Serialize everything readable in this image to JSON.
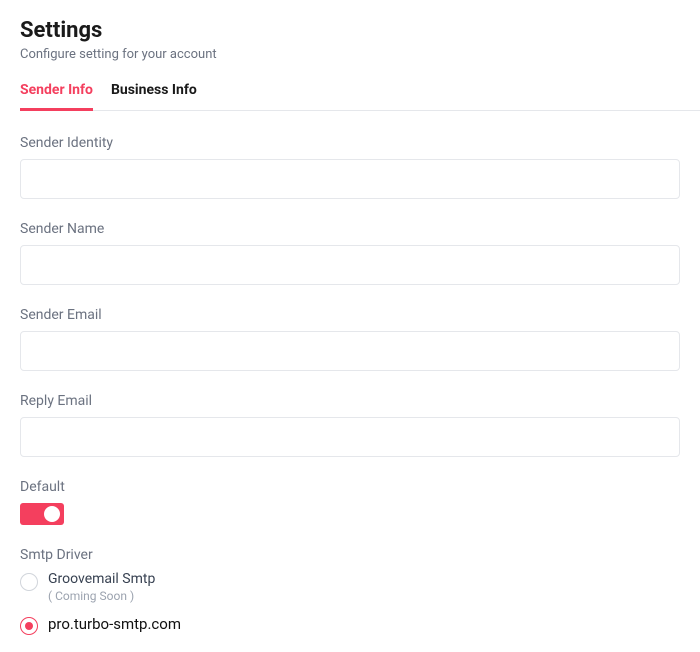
{
  "header": {
    "title": "Settings",
    "subtitle": "Configure setting for your account"
  },
  "tabs": {
    "sender_info": "Sender Info",
    "business_info": "Business Info"
  },
  "fields": {
    "sender_identity": {
      "label": "Sender Identity",
      "value": ""
    },
    "sender_name": {
      "label": "Sender Name",
      "value": ""
    },
    "sender_email": {
      "label": "Sender Email",
      "value": ""
    },
    "reply_email": {
      "label": "Reply Email",
      "value": ""
    }
  },
  "default_toggle": {
    "label": "Default",
    "value": true
  },
  "smtp_driver": {
    "label": "Smtp Driver",
    "options": {
      "groovemail": {
        "label": "Groovemail Smtp",
        "sublabel": "( Coming Soon )",
        "selected": false
      },
      "turbo": {
        "label": "pro.turbo-smtp.com",
        "selected": true
      }
    }
  }
}
